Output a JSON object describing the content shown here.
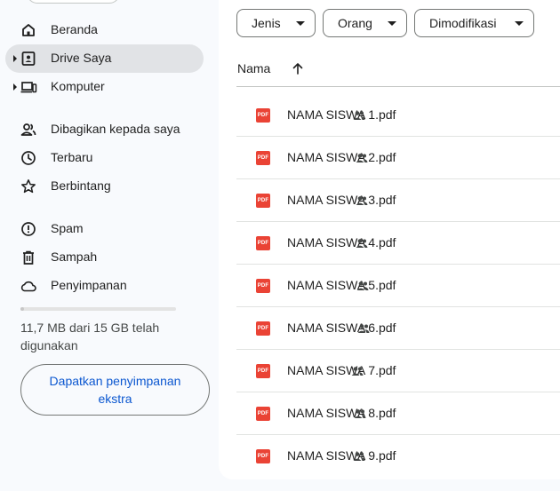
{
  "sidebar": {
    "items": [
      {
        "label": "Beranda",
        "icon": "home-icon"
      },
      {
        "label": "Drive Saya",
        "icon": "my-drive-icon",
        "active": true,
        "expandable": true
      },
      {
        "label": "Komputer",
        "icon": "computer-icon",
        "expandable": true
      },
      {
        "label": "Dibagikan kepada saya",
        "icon": "shared-with-me-icon"
      },
      {
        "label": "Terbaru",
        "icon": "clock-icon"
      },
      {
        "label": "Berbintang",
        "icon": "star-icon"
      },
      {
        "label": "Spam",
        "icon": "spam-icon"
      },
      {
        "label": "Sampah",
        "icon": "trash-icon"
      },
      {
        "label": "Penyimpanan",
        "icon": "cloud-icon"
      }
    ],
    "storage": {
      "used_fraction": 0.0008,
      "text": "11,7 MB dari 15 GB telah digunakan",
      "button_label": "Dapatkan penyimpanan ekstra"
    }
  },
  "filters": [
    {
      "label": "Jenis"
    },
    {
      "label": "Orang"
    },
    {
      "label": "Dimodifikasi"
    }
  ],
  "list": {
    "column_name": "Nama",
    "sort": "ascending",
    "files": [
      {
        "name": "NAMA SISWA 1.pdf",
        "type": "PDF",
        "shared": true
      },
      {
        "name": "NAMA SISWA 2.pdf",
        "type": "PDF",
        "shared": true
      },
      {
        "name": "NAMA SISWA 3.pdf",
        "type": "PDF",
        "shared": true
      },
      {
        "name": "NAMA SISWA 4.pdf",
        "type": "PDF",
        "shared": true
      },
      {
        "name": "NAMA SISWA 5.pdf",
        "type": "PDF",
        "shared": true
      },
      {
        "name": "NAMA SISWA 6.pdf",
        "type": "PDF",
        "shared": true
      },
      {
        "name": "NAMA SISWA 7.pdf",
        "type": "PDF",
        "shared": true
      },
      {
        "name": "NAMA SISWA 8.pdf",
        "type": "PDF",
        "shared": true
      },
      {
        "name": "NAMA SISWA 9.pdf",
        "type": "PDF",
        "shared": true
      }
    ]
  },
  "colors": {
    "accent": "#0b57d0",
    "pdf_red": "#ea4335",
    "active_nav": "#e1e3e6",
    "sidebar_bg": "#f8fafd"
  }
}
